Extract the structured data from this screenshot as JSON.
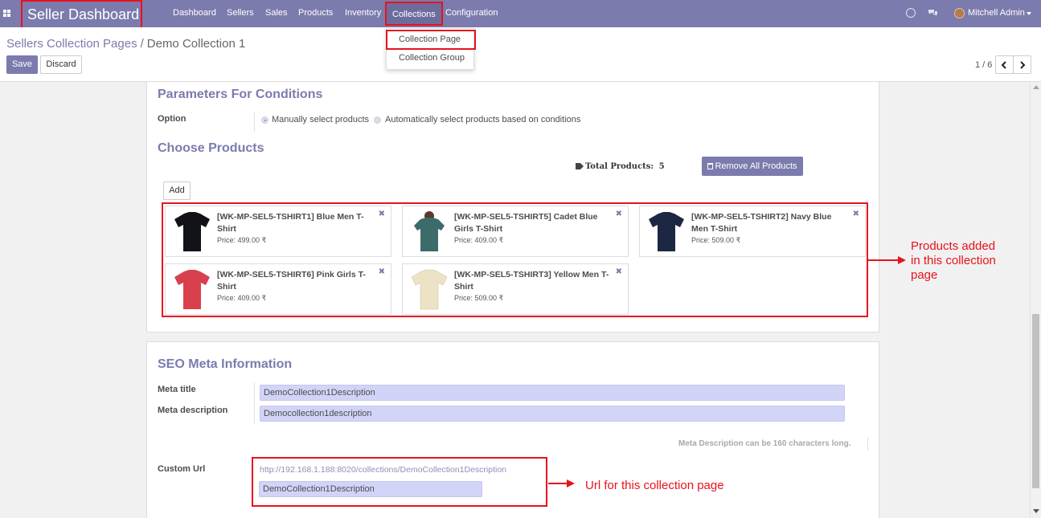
{
  "navbar": {
    "brand": "Seller Dashboard",
    "menu": [
      "Dashboard",
      "Sellers",
      "Sales",
      "Products",
      "Inventory",
      "Collections",
      "Configuration"
    ],
    "user": "Mitchell Admin"
  },
  "dropdown": {
    "items": [
      "Collection Page",
      "Collection Group"
    ]
  },
  "breadcrumb": {
    "parent": "Sellers Collection Pages",
    "separator": "/",
    "current": "Demo Collection 1"
  },
  "buttons": {
    "save": "Save",
    "discard": "Discard"
  },
  "pager": {
    "value": "1 / 6"
  },
  "conditions": {
    "title": "Parameters For Conditions",
    "option_label": "Option",
    "radio_manual": "Manually select products",
    "radio_auto": "Automatically select products based on conditions"
  },
  "choose": {
    "title": "Choose Products",
    "total_label": "Total Products:",
    "total_value": "5",
    "remove_all": "Remove All Products",
    "add": "Add"
  },
  "products": [
    {
      "name": "[WK-MP-SEL5-TSHIRT1] Blue Men T-Shirt",
      "price": "Price: 499.00 ₹",
      "color": "#111319"
    },
    {
      "name": "[WK-MP-SEL5-TSHIRT5] Cadet Blue Girls T-Shirt",
      "price": "Price: 409.00 ₹",
      "color": "#3d6b6a"
    },
    {
      "name": "[WK-MP-SEL5-TSHIRT2] Navy Blue Men T-Shirt",
      "price": "Price: 509.00 ₹",
      "color": "#1c2843"
    },
    {
      "name": "[WK-MP-SEL5-TSHIRT6] Pink Girls T-Shirt",
      "price": "Price: 409.00 ₹",
      "color": "#d8404d"
    },
    {
      "name": "[WK-MP-SEL5-TSHIRT3] Yellow Men T-Shirt",
      "price": "Price: 509.00 ₹",
      "color": "#ece3c6"
    }
  ],
  "annotations": {
    "products_added": [
      "Products added",
      "in this collection",
      "page"
    ],
    "url_note": "Url for this collection page"
  },
  "seo": {
    "title": "SEO Meta Information",
    "meta_title_label": "Meta title",
    "meta_title_value": "DemoCollection1Description",
    "meta_desc_label": "Meta description",
    "meta_desc_value": "Democollection1description",
    "help": "Meta Description can be 160 characters long.",
    "custom_url_label": "Custom Url",
    "url_link": "http://192.168.1.188:8020/collections/DemoCollection1Description",
    "url_value": "DemoCollection1Description"
  },
  "colors": {
    "brand": "#7c7bad",
    "highlight": "#e8121c",
    "input_bg": "#d2d4f7"
  }
}
